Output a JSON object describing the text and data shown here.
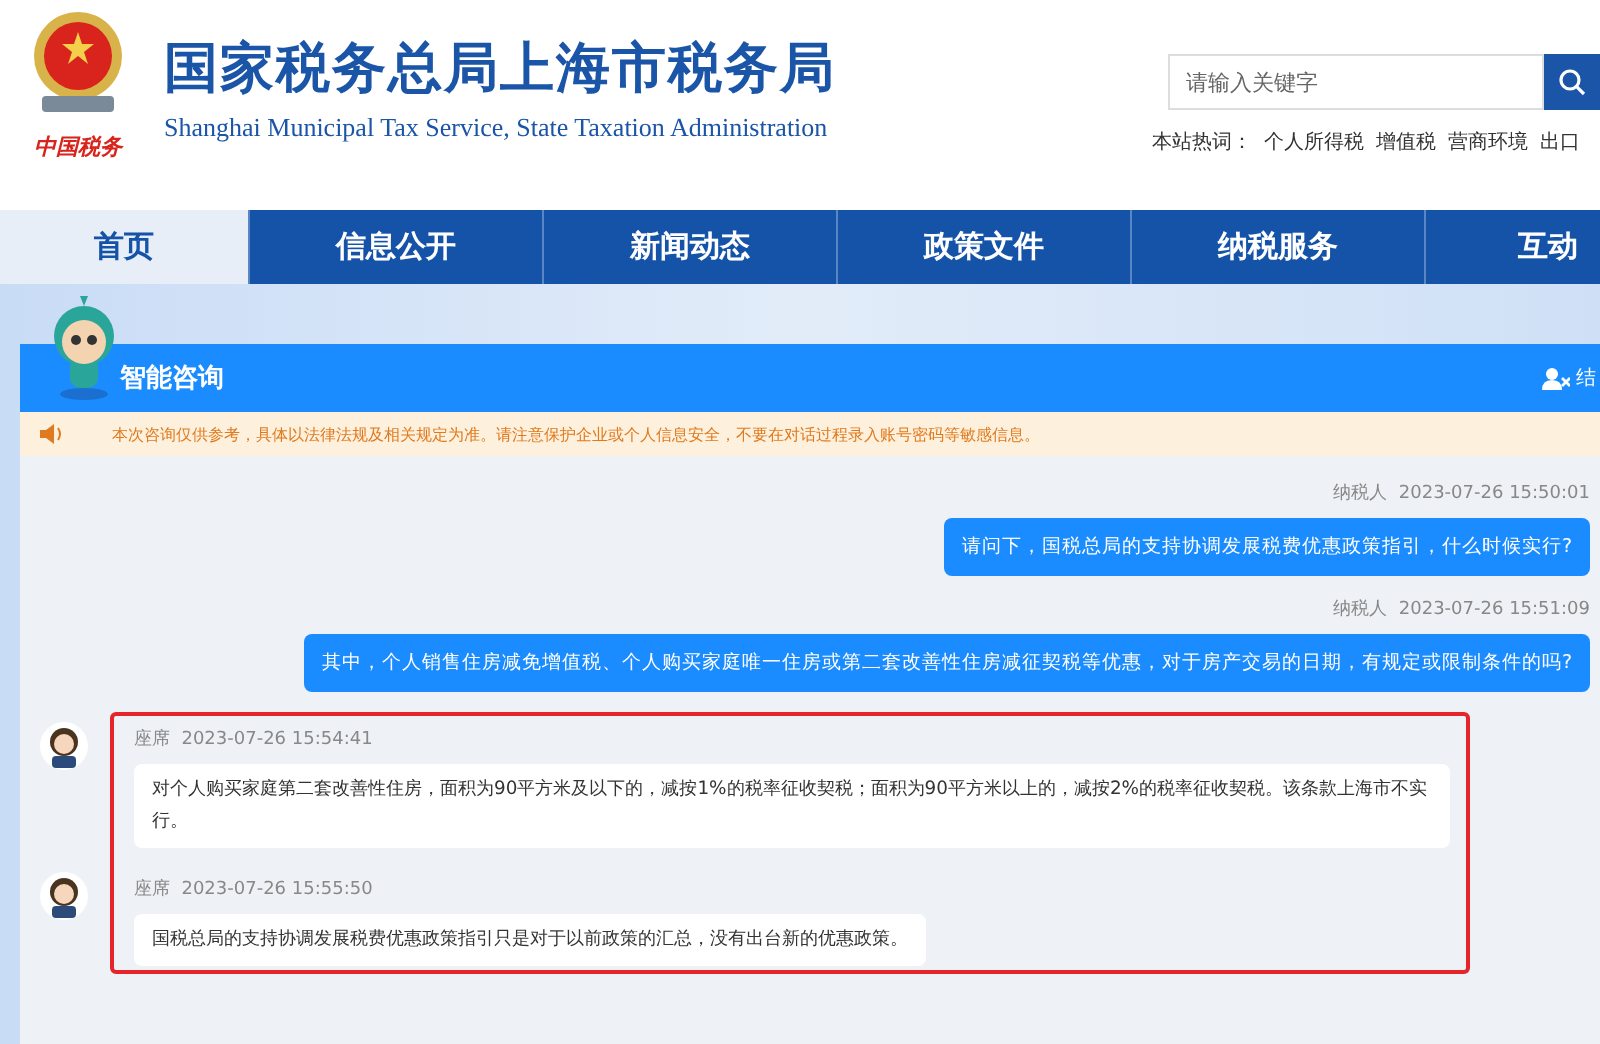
{
  "header": {
    "title": "国家税务总局上海市税务局",
    "subtitle": "Shanghai Municipal Tax Service, State Taxation Administration",
    "logo_text": "中国税务",
    "search": {
      "placeholder": "请输入关键字"
    },
    "hot_label": "本站热词：",
    "hot_words": [
      "个人所得税",
      "增值税",
      "营商环境",
      "出口"
    ]
  },
  "nav": [
    {
      "label": "首页",
      "selected": true
    },
    {
      "label": "信息公开",
      "selected": false
    },
    {
      "label": "新闻动态",
      "selected": false
    },
    {
      "label": "政策文件",
      "selected": false
    },
    {
      "label": "纳税服务",
      "selected": false
    },
    {
      "label": "互动",
      "selected": false
    }
  ],
  "chat": {
    "title": "智能咨询",
    "end_button": "结",
    "notice": "本次咨询仅供参考，具体以法律法规及相关规定为准。请注意保护企业或个人信息安全，不要在对话过程录入账号密码等敏感信息。",
    "messages": [
      {
        "kind": "user",
        "sender": "纳税人",
        "time": "2023-07-26 15:50:01",
        "text": "请问下，国税总局的支持协调发展税费优惠政策指引，什么时候实行?",
        "highlighted": false
      },
      {
        "kind": "user",
        "sender": "纳税人",
        "time": "2023-07-26 15:51:09",
        "text": "其中，个人销售住房减免增值税、个人购买家庭唯一住房或第二套改善性住房减征契税等优惠，对于房产交易的日期，有规定或限制条件的吗?",
        "highlighted": false
      },
      {
        "kind": "agent",
        "sender": "座席",
        "time": "2023-07-26 15:54:41",
        "text": "对个人购买家庭第二套改善性住房，面积为90平方米及以下的，减按1%的税率征收契税；面积为90平方米以上的，减按2%的税率征收契税。该条款上海市不实行。",
        "highlighted": true
      },
      {
        "kind": "agent",
        "sender": "座席",
        "time": "2023-07-26 15:55:50",
        "text": "国税总局的支持协调发展税费优惠政策指引只是对于以前政策的汇总，没有出台新的优惠政策。",
        "highlighted": true
      }
    ]
  }
}
